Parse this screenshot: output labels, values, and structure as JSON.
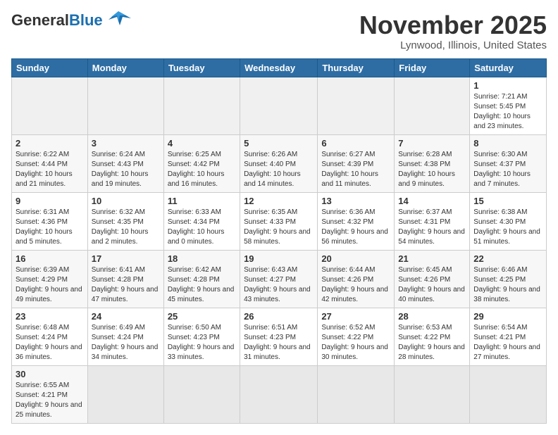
{
  "header": {
    "logo_general": "General",
    "logo_blue": "Blue",
    "month_title": "November 2025",
    "location": "Lynwood, Illinois, United States"
  },
  "weekdays": [
    "Sunday",
    "Monday",
    "Tuesday",
    "Wednesday",
    "Thursday",
    "Friday",
    "Saturday"
  ],
  "weeks": [
    [
      {
        "day": "",
        "info": ""
      },
      {
        "day": "",
        "info": ""
      },
      {
        "day": "",
        "info": ""
      },
      {
        "day": "",
        "info": ""
      },
      {
        "day": "",
        "info": ""
      },
      {
        "day": "",
        "info": ""
      },
      {
        "day": "1",
        "info": "Sunrise: 7:21 AM\nSunset: 5:45 PM\nDaylight: 10 hours and 23 minutes."
      }
    ],
    [
      {
        "day": "2",
        "info": "Sunrise: 6:22 AM\nSunset: 4:44 PM\nDaylight: 10 hours and 21 minutes."
      },
      {
        "day": "3",
        "info": "Sunrise: 6:24 AM\nSunset: 4:43 PM\nDaylight: 10 hours and 19 minutes."
      },
      {
        "day": "4",
        "info": "Sunrise: 6:25 AM\nSunset: 4:42 PM\nDaylight: 10 hours and 16 minutes."
      },
      {
        "day": "5",
        "info": "Sunrise: 6:26 AM\nSunset: 4:40 PM\nDaylight: 10 hours and 14 minutes."
      },
      {
        "day": "6",
        "info": "Sunrise: 6:27 AM\nSunset: 4:39 PM\nDaylight: 10 hours and 11 minutes."
      },
      {
        "day": "7",
        "info": "Sunrise: 6:28 AM\nSunset: 4:38 PM\nDaylight: 10 hours and 9 minutes."
      },
      {
        "day": "8",
        "info": "Sunrise: 6:30 AM\nSunset: 4:37 PM\nDaylight: 10 hours and 7 minutes."
      }
    ],
    [
      {
        "day": "9",
        "info": "Sunrise: 6:31 AM\nSunset: 4:36 PM\nDaylight: 10 hours and 5 minutes."
      },
      {
        "day": "10",
        "info": "Sunrise: 6:32 AM\nSunset: 4:35 PM\nDaylight: 10 hours and 2 minutes."
      },
      {
        "day": "11",
        "info": "Sunrise: 6:33 AM\nSunset: 4:34 PM\nDaylight: 10 hours and 0 minutes."
      },
      {
        "day": "12",
        "info": "Sunrise: 6:35 AM\nSunset: 4:33 PM\nDaylight: 9 hours and 58 minutes."
      },
      {
        "day": "13",
        "info": "Sunrise: 6:36 AM\nSunset: 4:32 PM\nDaylight: 9 hours and 56 minutes."
      },
      {
        "day": "14",
        "info": "Sunrise: 6:37 AM\nSunset: 4:31 PM\nDaylight: 9 hours and 54 minutes."
      },
      {
        "day": "15",
        "info": "Sunrise: 6:38 AM\nSunset: 4:30 PM\nDaylight: 9 hours and 51 minutes."
      }
    ],
    [
      {
        "day": "16",
        "info": "Sunrise: 6:39 AM\nSunset: 4:29 PM\nDaylight: 9 hours and 49 minutes."
      },
      {
        "day": "17",
        "info": "Sunrise: 6:41 AM\nSunset: 4:28 PM\nDaylight: 9 hours and 47 minutes."
      },
      {
        "day": "18",
        "info": "Sunrise: 6:42 AM\nSunset: 4:28 PM\nDaylight: 9 hours and 45 minutes."
      },
      {
        "day": "19",
        "info": "Sunrise: 6:43 AM\nSunset: 4:27 PM\nDaylight: 9 hours and 43 minutes."
      },
      {
        "day": "20",
        "info": "Sunrise: 6:44 AM\nSunset: 4:26 PM\nDaylight: 9 hours and 42 minutes."
      },
      {
        "day": "21",
        "info": "Sunrise: 6:45 AM\nSunset: 4:26 PM\nDaylight: 9 hours and 40 minutes."
      },
      {
        "day": "22",
        "info": "Sunrise: 6:46 AM\nSunset: 4:25 PM\nDaylight: 9 hours and 38 minutes."
      }
    ],
    [
      {
        "day": "23",
        "info": "Sunrise: 6:48 AM\nSunset: 4:24 PM\nDaylight: 9 hours and 36 minutes."
      },
      {
        "day": "24",
        "info": "Sunrise: 6:49 AM\nSunset: 4:24 PM\nDaylight: 9 hours and 34 minutes."
      },
      {
        "day": "25",
        "info": "Sunrise: 6:50 AM\nSunset: 4:23 PM\nDaylight: 9 hours and 33 minutes."
      },
      {
        "day": "26",
        "info": "Sunrise: 6:51 AM\nSunset: 4:23 PM\nDaylight: 9 hours and 31 minutes."
      },
      {
        "day": "27",
        "info": "Sunrise: 6:52 AM\nSunset: 4:22 PM\nDaylight: 9 hours and 30 minutes."
      },
      {
        "day": "28",
        "info": "Sunrise: 6:53 AM\nSunset: 4:22 PM\nDaylight: 9 hours and 28 minutes."
      },
      {
        "day": "29",
        "info": "Sunrise: 6:54 AM\nSunset: 4:21 PM\nDaylight: 9 hours and 27 minutes."
      }
    ],
    [
      {
        "day": "30",
        "info": "Sunrise: 6:55 AM\nSunset: 4:21 PM\nDaylight: 9 hours and 25 minutes."
      },
      {
        "day": "",
        "info": ""
      },
      {
        "day": "",
        "info": ""
      },
      {
        "day": "",
        "info": ""
      },
      {
        "day": "",
        "info": ""
      },
      {
        "day": "",
        "info": ""
      },
      {
        "day": "",
        "info": ""
      }
    ]
  ]
}
